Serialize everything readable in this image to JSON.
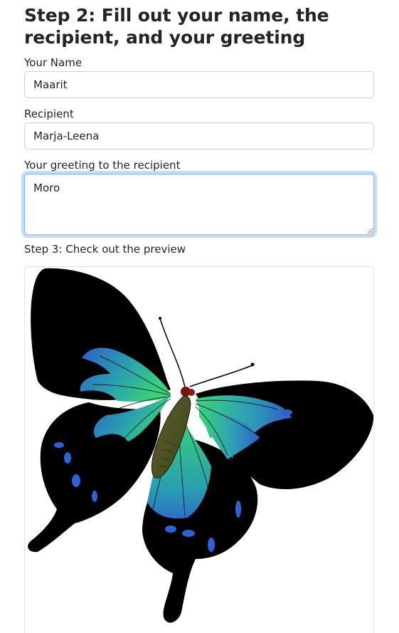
{
  "step2": {
    "title": "Step 2: Fill out your name, the recipient, and your greeting",
    "name_label": "Your Name",
    "name_value": "Maarit",
    "recipient_label": "Recipient",
    "recipient_value": "Marja-Leena",
    "greeting_label": "Your greeting to the recipient",
    "greeting_value": "Moro"
  },
  "step3": {
    "title": "Step 3: Check out the preview",
    "preview_image": "butterfly-card-image"
  },
  "colors": {
    "focus_border": "#86b7fe",
    "wing_teal": "#2ecc71",
    "wing_blue": "#2a6fdb",
    "wing_black": "#000000"
  }
}
